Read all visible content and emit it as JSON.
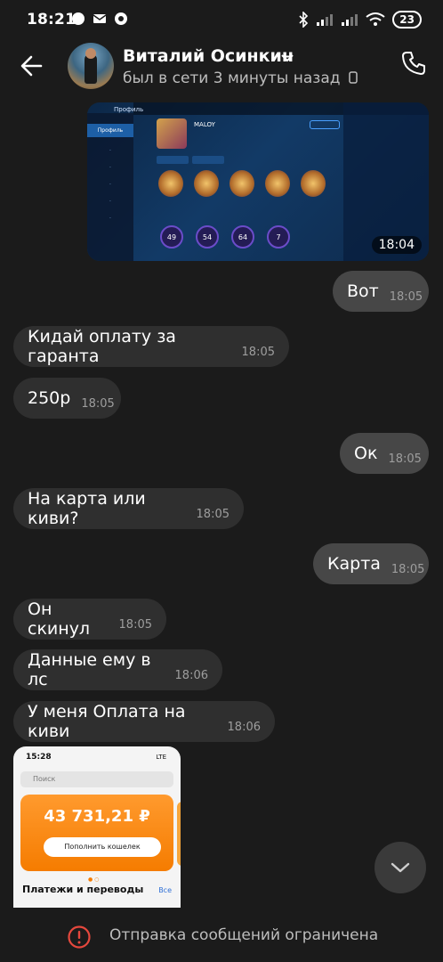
{
  "status_bar": {
    "time": "18:21",
    "battery": "23"
  },
  "header": {
    "contact_name": "Виталий Осинкин",
    "contact_status": "был в сети 3 минуты назад"
  },
  "messages": [
    {
      "direction": "out",
      "type": "image",
      "time": "18:04"
    },
    {
      "direction": "out",
      "text": "Вот",
      "time": "18:05"
    },
    {
      "direction": "in",
      "text": "Кидай оплату за гаранта",
      "time": "18:05"
    },
    {
      "direction": "in",
      "text": "250р",
      "time": "18:05"
    },
    {
      "direction": "out",
      "text": "Ок",
      "time": "18:05"
    },
    {
      "direction": "in",
      "text": "На карта или киви?",
      "time": "18:05"
    },
    {
      "direction": "out",
      "text": "Карта",
      "time": "18:05"
    },
    {
      "direction": "in",
      "text": "Он скинул",
      "time": "18:05"
    },
    {
      "direction": "in",
      "text": "Данные ему в лс",
      "time": "18:06"
    },
    {
      "direction": "in",
      "text": "У меня Оплата на киви",
      "time": "18:06"
    },
    {
      "direction": "in",
      "type": "image"
    }
  ],
  "game_image": {
    "profile_label": "Профиль",
    "player_name": "MALOY",
    "stats": [
      "49",
      "54",
      "64",
      "7"
    ]
  },
  "qiwi_image": {
    "time": "15:28",
    "network": "LTE",
    "search_placeholder": "Поиск",
    "balance": "43 731,21 ₽",
    "topup_button": "Пополнить кошелек",
    "section_title": "Платежи и переводы",
    "all_link": "Все"
  },
  "bottom_bar": {
    "restriction_text": "Отправка сообщений ограничена"
  },
  "colors": {
    "background": "#1b1b1b",
    "incoming_bubble": "#2f2f2f",
    "outgoing_bubble": "#474747",
    "restriction_icon": "#e5483d",
    "qiwi_orange": "#f57c00"
  }
}
